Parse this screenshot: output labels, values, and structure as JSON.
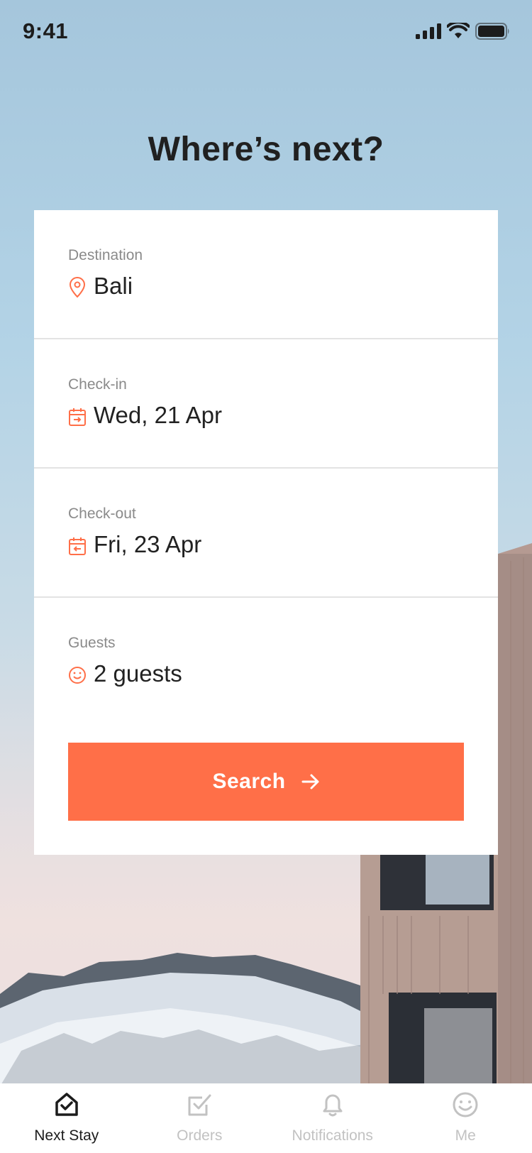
{
  "status_bar": {
    "time": "9:41"
  },
  "page_title": "Where’s next?",
  "form": {
    "destination": {
      "label": "Destination",
      "value": "Bali",
      "icon": "location-pin-icon"
    },
    "check_in": {
      "label": "Check-in",
      "value": "Wed,  21 Apr",
      "icon": "calendar-in-icon"
    },
    "check_out": {
      "label": "Check-out",
      "value": "Fri,  23 Apr",
      "icon": "calendar-out-icon"
    },
    "guests": {
      "label": "Guests",
      "value": "2 guests",
      "icon": "smiley-icon"
    },
    "search_label": "Search"
  },
  "tabbar": {
    "items": [
      {
        "label": "Next Stay",
        "icon": "home-check-icon",
        "active": true
      },
      {
        "label": "Orders",
        "icon": "checkbox-icon",
        "active": false
      },
      {
        "label": "Notifications",
        "icon": "bell-icon",
        "active": false
      },
      {
        "label": "Me",
        "icon": "smiley-icon",
        "active": false
      }
    ]
  },
  "colors": {
    "accent": "#FF6F48",
    "text": "#222222",
    "muted": "#8A8A8A",
    "tab_inactive": "#C2C2C2"
  }
}
